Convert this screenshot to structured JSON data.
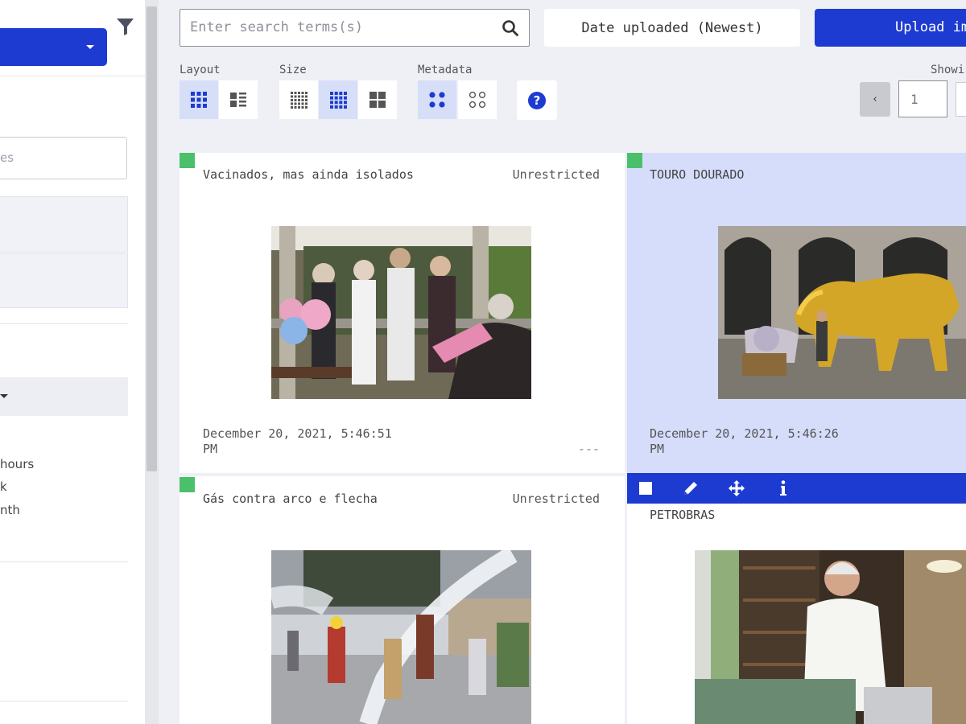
{
  "sidebar": {
    "search_placeholder": "es",
    "options": [
      "hours",
      "k",
      "nth"
    ]
  },
  "toolbar": {
    "search_placeholder": "Enter search terms(s)",
    "sort_label": "Date uploaded (Newest)",
    "upload_label": "Upload ima",
    "layout_label": "Layout",
    "size_label": "Size",
    "metadata_label": "Metadata",
    "help_label": "?",
    "showing_label": "Showi",
    "prev_label": "‹",
    "page_value": "1"
  },
  "cards": [
    {
      "title": "Vacinados, mas ainda isolados",
      "rights": "Unrestricted",
      "date": "December 20, 2021, 5:46:51 PM",
      "extra": "---",
      "status_color": "#4bc06b"
    },
    {
      "title": "TOURO DOURADO",
      "date": "December 20, 2021, 5:46:26 PM",
      "status_color": "#4bc06b"
    },
    {
      "title": "Gás contra arco e flecha",
      "rights": "Unrestricted",
      "status_color": "#4bc06b"
    },
    {
      "title": "PETROBRAS"
    }
  ],
  "colors": {
    "accent": "#1d3bd1",
    "selected_card": "#d5ddfb",
    "status_green": "#4bc06b",
    "page_bg": "#eef0f6"
  },
  "icons": {
    "filter": "filter-icon",
    "search": "search-icon",
    "grid_layout": "grid-layout-icon",
    "list_layout": "list-layout-icon",
    "size_small": "small-grid-icon",
    "size_medium": "medium-grid-icon",
    "size_large": "large-grid-icon",
    "meta_on": "metadata-filled-icon",
    "meta_off": "metadata-outline-icon",
    "help": "help-icon",
    "select": "checkbox-icon",
    "edit": "pencil-icon",
    "move": "move-icon",
    "info": "info-icon"
  }
}
